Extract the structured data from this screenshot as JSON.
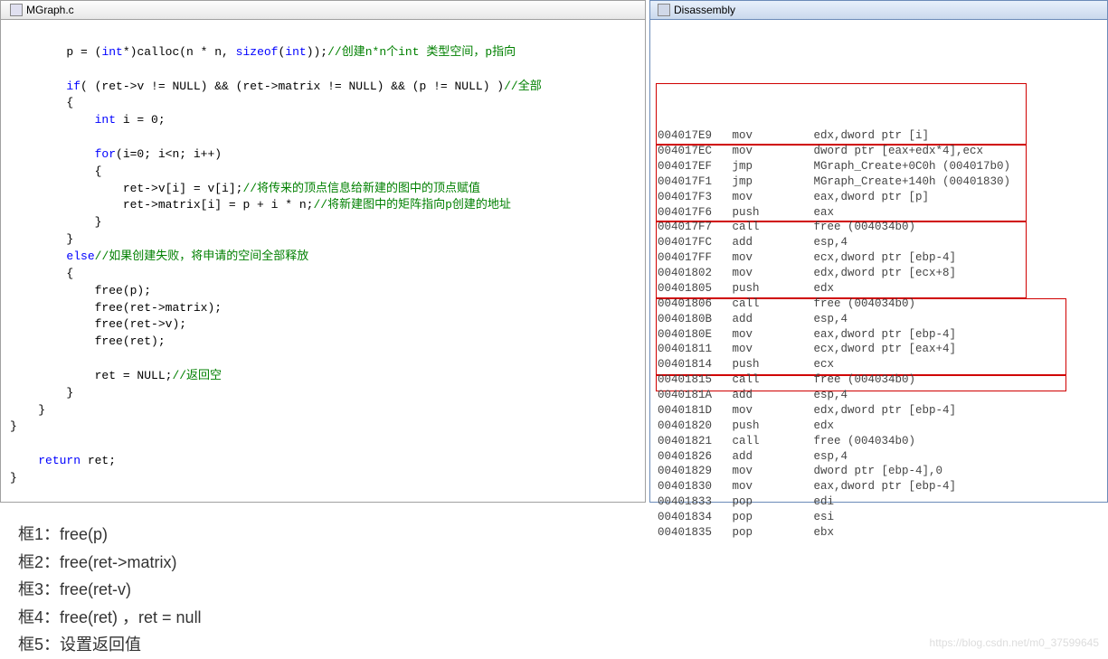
{
  "code_tab": "MGraph.c",
  "disasm_title": "Disassembly",
  "code": {
    "l1a": "p = (",
    "l1b": "int",
    "l1c": "*)calloc(n * n, ",
    "l1d": "sizeof",
    "l1e": "(",
    "l1f": "int",
    "l1g": "));",
    "l1h": "//创建n*n个int 类型空间，p指向",
    "l2a": "if",
    "l2b": "( (ret->v != NULL) && (ret->matrix != NULL) && (p != NULL) )",
    "l2c": "//全部",
    "l3": "{",
    "l4a": "int",
    "l4b": " i = 0;",
    "l5a": "for",
    "l5b": "(i=0; i<n; i++)",
    "l6": "{",
    "l7a": "ret->v[i] = v[i];",
    "l7b": "//将传来的顶点信息给新建的图中的顶点赋值",
    "l8a": "ret->matrix[i] = p + i * n;",
    "l8b": "//将新建图中的矩阵指向p创建的地址",
    "l9": "}",
    "l10": "}",
    "l11a": "else",
    "l11b": "//如果创建失败，将申请的空间全部释放",
    "l12": "{",
    "l13": "free(p);",
    "l14": "free(ret->matrix);",
    "l15": "free(ret->v);",
    "l16": "free(ret);",
    "l17a": "ret = NULL;",
    "l17b": "//返回空",
    "l18": "}",
    "l19": "}",
    "l20": "}",
    "l21a": "return",
    "l21b": " ret;",
    "l22": "}"
  },
  "disasm": [
    {
      "addr": "004017E9",
      "op": "mov",
      "args": "edx,dword ptr [i]"
    },
    {
      "addr": "004017EC",
      "op": "mov",
      "args": "dword ptr [eax+edx*4],ecx"
    },
    {
      "addr": "004017EF",
      "op": "jmp",
      "args": "MGraph_Create+0C0h (004017b0)"
    },
    {
      "addr": "004017F1",
      "op": "jmp",
      "args": "MGraph_Create+140h (00401830)"
    },
    {
      "addr": "004017F3",
      "op": "mov",
      "args": "eax,dword ptr [p]"
    },
    {
      "addr": "004017F6",
      "op": "push",
      "args": "eax"
    },
    {
      "addr": "004017F7",
      "op": "call",
      "args": "free (004034b0)"
    },
    {
      "addr": "004017FC",
      "op": "add",
      "args": "esp,4"
    },
    {
      "addr": "004017FF",
      "op": "mov",
      "args": "ecx,dword ptr [ebp-4]"
    },
    {
      "addr": "00401802",
      "op": "mov",
      "args": "edx,dword ptr [ecx+8]"
    },
    {
      "addr": "00401805",
      "op": "push",
      "args": "edx"
    },
    {
      "addr": "00401806",
      "op": "call",
      "args": "free (004034b0)"
    },
    {
      "addr": "0040180B",
      "op": "add",
      "args": "esp,4"
    },
    {
      "addr": "0040180E",
      "op": "mov",
      "args": "eax,dword ptr [ebp-4]"
    },
    {
      "addr": "00401811",
      "op": "mov",
      "args": "ecx,dword ptr [eax+4]"
    },
    {
      "addr": "00401814",
      "op": "push",
      "args": "ecx"
    },
    {
      "addr": "00401815",
      "op": "call",
      "args": "free (004034b0)"
    },
    {
      "addr": "0040181A",
      "op": "add",
      "args": "esp,4"
    },
    {
      "addr": "0040181D",
      "op": "mov",
      "args": "edx,dword ptr [ebp-4]"
    },
    {
      "addr": "00401820",
      "op": "push",
      "args": "edx"
    },
    {
      "addr": "00401821",
      "op": "call",
      "args": "free (004034b0)"
    },
    {
      "addr": "00401826",
      "op": "add",
      "args": "esp,4"
    },
    {
      "addr": "00401829",
      "op": "mov",
      "args": "dword ptr [ebp-4],0"
    },
    {
      "addr": "00401830",
      "op": "mov",
      "args": "eax,dword ptr [ebp-4]"
    },
    {
      "addr": "00401833",
      "op": "pop",
      "args": "edi"
    },
    {
      "addr": "00401834",
      "op": "pop",
      "args": "esi"
    },
    {
      "addr": "00401835",
      "op": "pop",
      "args": "ebx"
    }
  ],
  "annotations": [
    "框1：free(p)",
    "框2：free(ret->matrix)",
    "框3：free(ret-v)",
    "框4：free(ret) ，ret = null",
    "框5：设置返回值"
  ],
  "watermark": "https://blog.csdn.net/m0_37599645"
}
